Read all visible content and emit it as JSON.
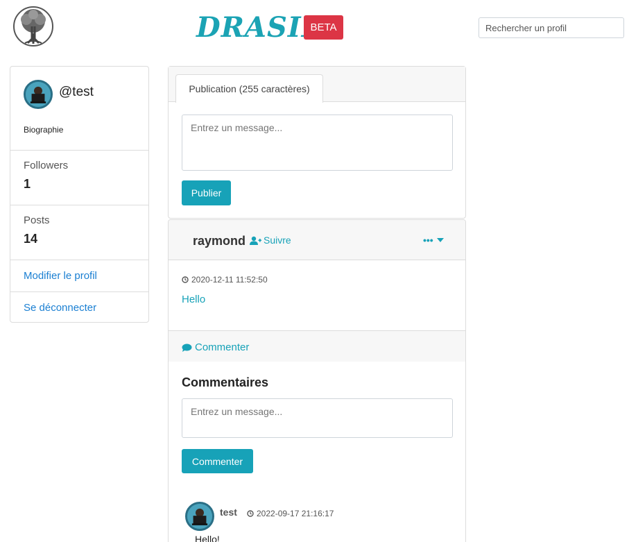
{
  "header": {
    "logo_icon": "tree-of-life-icon",
    "brand": "DRASIL",
    "badge": "BETA",
    "search_placeholder": "Rechercher un profil"
  },
  "profile": {
    "handle": "@test",
    "bio": "Biographie",
    "stats": [
      {
        "label": "Followers",
        "value": "1"
      },
      {
        "label": "Posts",
        "value": "14"
      }
    ],
    "edit_link": "Modifier le profil",
    "logout_link": "Se déconnecter"
  },
  "publication": {
    "tab_label": "Publication (255 caractères)",
    "placeholder": "Entrez un message...",
    "submit_label": "Publier"
  },
  "post": {
    "author": "raymond",
    "follow_label": "Suivre",
    "date": "2020-12-11 11:52:50",
    "text": "Hello",
    "comment_link": "Commenter",
    "comments_title": "Commentaires",
    "comment_placeholder": "Entrez un message...",
    "comment_submit": "Commenter",
    "comments": [
      {
        "author": "test",
        "date": "2022-09-17 21:16:17",
        "text": "Hello!"
      }
    ]
  },
  "colors": {
    "accent": "#17a2b8",
    "badge": "#dc3545",
    "link": "#1a7fd2"
  }
}
